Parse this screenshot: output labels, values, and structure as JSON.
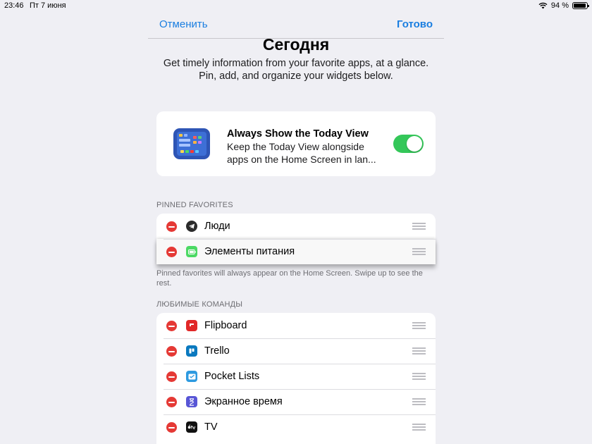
{
  "status_bar": {
    "time": "23:46",
    "date": "Пт 7 июня",
    "battery": "94 %",
    "battery_level": 0.94
  },
  "nav": {
    "cancel": "Отменить",
    "done": "Готово"
  },
  "header": {
    "title": "Сегодня",
    "subtitle_line1": "Get timely information from your favorite apps, at a glance.",
    "subtitle_line2": "Pin, add, and organize your widgets below."
  },
  "today_view": {
    "title": "Always Show the Today View",
    "description": "Keep the Today View alongside apps on the Home Screen in lan...",
    "toggle_on": true
  },
  "pinned": {
    "header": "PINNED FAVORITES",
    "items": [
      {
        "label": "Люди",
        "icon": "telegram-icon"
      },
      {
        "label": "Элементы питания",
        "icon": "battery-icon"
      }
    ],
    "footer": "Pinned favorites will always appear on the Home Screen. Swipe up to see the rest."
  },
  "favorites": {
    "header": "ЛЮБИМЫЕ КОМАНДЫ",
    "items": [
      {
        "label": "Flipboard",
        "icon": "flipboard-icon"
      },
      {
        "label": "Trello",
        "icon": "trello-icon"
      },
      {
        "label": "Pocket Lists",
        "icon": "pocket-lists-icon"
      },
      {
        "label": "Экранное время",
        "icon": "hourglass-icon"
      },
      {
        "label": "TV",
        "icon": "apple-tv-icon"
      }
    ]
  },
  "colors": {
    "accent": "#1a7ee0",
    "toggle_on": "#34c759",
    "delete": "#e53935",
    "background": "#efeff4"
  }
}
